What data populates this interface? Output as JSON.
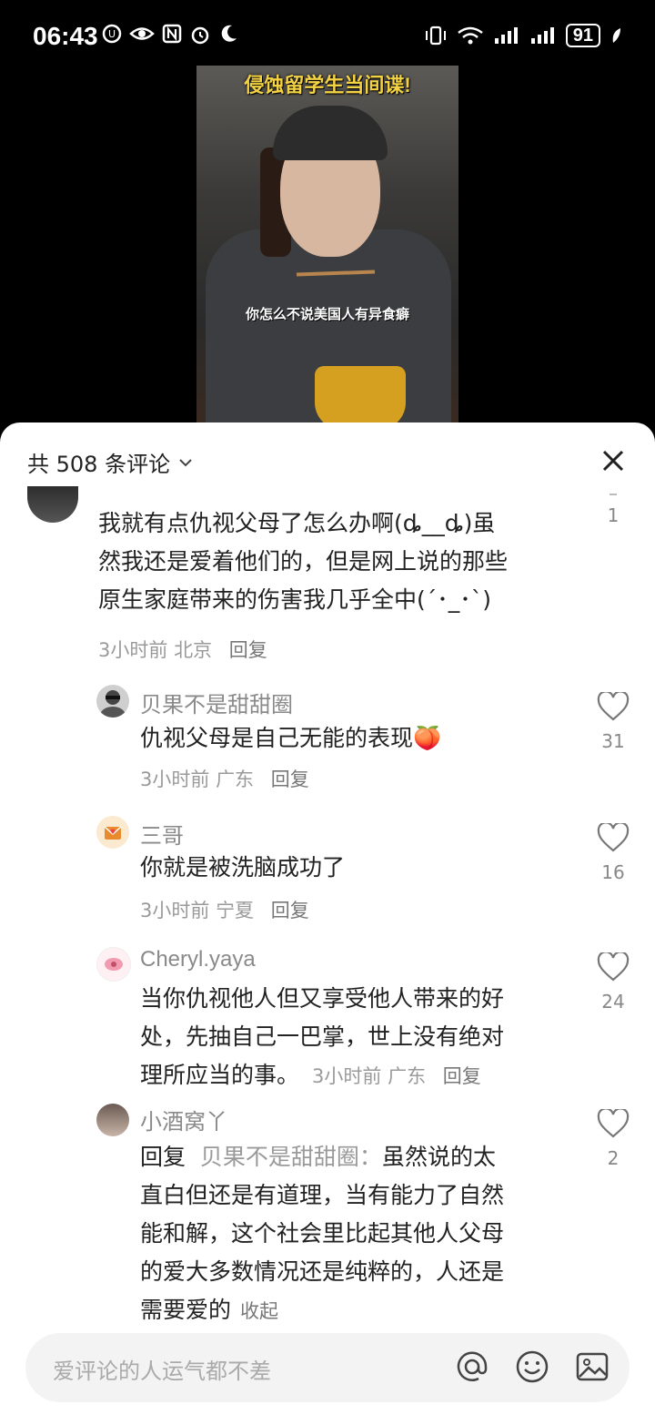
{
  "status_bar": {
    "time": "06:43",
    "battery": "91"
  },
  "video": {
    "caption": "侵蚀留学生当间谍!",
    "subtitle": "你怎么不说美国人有异食癖"
  },
  "comments_header": {
    "title": "共 508 条评论"
  },
  "comments": [
    {
      "text_lines": [
        "我就有点仇视父母了怎么办啊(ȡ__ȡ)虽",
        "然我还是爱着他们的，但是网上说的那些",
        "原生家庭带来的伤害我几乎全中(´･_･`)"
      ],
      "time": "3小时前",
      "location": "北京",
      "reply_label": "回复",
      "likes": "1"
    }
  ],
  "replies": [
    {
      "username": "贝果不是甜甜圈",
      "text": "仇视父母是自己无能的表现",
      "emoji": "🍑",
      "time": "3小时前",
      "location": "广东",
      "reply_label": "回复",
      "likes": "31"
    },
    {
      "username": "三哥",
      "text": "你就是被洗脑成功了",
      "time": "3小时前",
      "location": "宁夏",
      "reply_label": "回复",
      "likes": "16"
    },
    {
      "username": "Cheryl.yaya",
      "text_lines": [
        "当你仇视他人但又享受他人带来的好",
        "处，先抽自己一巴掌，世上没有绝对",
        "理所应当的事。"
      ],
      "time": "3小时前",
      "location": "广东",
      "reply_label": "回复",
      "likes": "24"
    },
    {
      "username": "小酒窝丫",
      "reply_prefix": "回复",
      "reply_to": "贝果不是甜甜圈：",
      "text_lines": [
        "虽然说的太",
        "直白但还是有道理，当有能力了自然",
        "能和解，这个社会里比起其他人父母",
        "的爱大多数情况还是纯粹的，人还是",
        "需要爱的"
      ],
      "collapse_label": "收起",
      "likes": "2"
    }
  ],
  "input": {
    "placeholder": "爱评论的人运气都不差"
  },
  "icons": [
    "chevron-down-icon",
    "close-icon",
    "heart-icon",
    "at-icon",
    "emoji-icon",
    "image-icon"
  ]
}
